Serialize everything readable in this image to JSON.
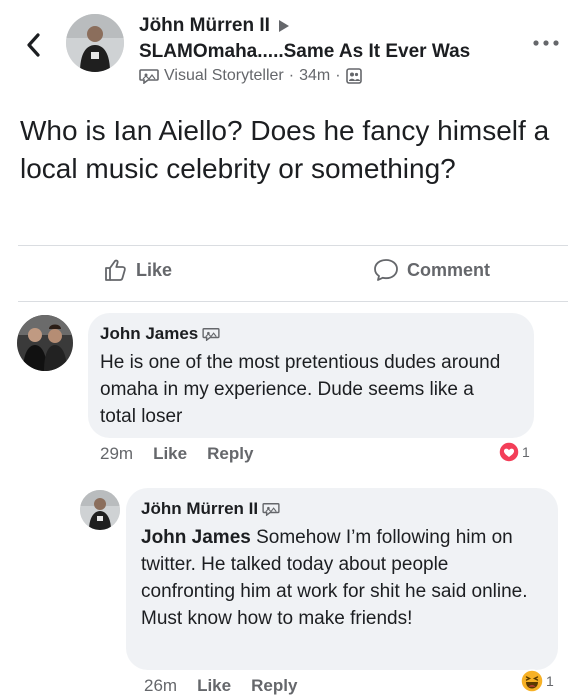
{
  "post": {
    "author": "Jöhn Mürren II",
    "group": "SLAMOmaha.....Same As It Ever Was",
    "badge": "Visual Storyteller",
    "time": "34m",
    "text": "Who is Ian Aiello? Does he fancy himself a local music celebrity or something?"
  },
  "actions": {
    "like": "Like",
    "comment": "Comment"
  },
  "comments": [
    {
      "name": "John James",
      "text": "He is one of the most pretentious  dudes around omaha in my experience. Dude seems like a total loser",
      "time": "29m",
      "like": "Like",
      "reply": "Reply",
      "reaction_count": "1",
      "reaction_type": "love",
      "reaction_color": "#f33e58"
    },
    {
      "name": "Jöhn Mürren II",
      "mention": "John James",
      "text": " Somehow I’m following him on twitter. He talked today about people confronting him at work for shit he said online. Must know how to make friends!",
      "time": "26m",
      "like": "Like",
      "reply": "Reply",
      "reaction_count": "1",
      "reaction_type": "haha",
      "reaction_color": "#f7b125"
    }
  ],
  "icons": {
    "back": "chevron-left-icon",
    "more": "more-horizontal-icon",
    "badge": "storyteller-badge-icon",
    "privacy": "group-privacy-icon",
    "like": "thumbs-up-icon",
    "comment": "speech-bubble-icon"
  }
}
